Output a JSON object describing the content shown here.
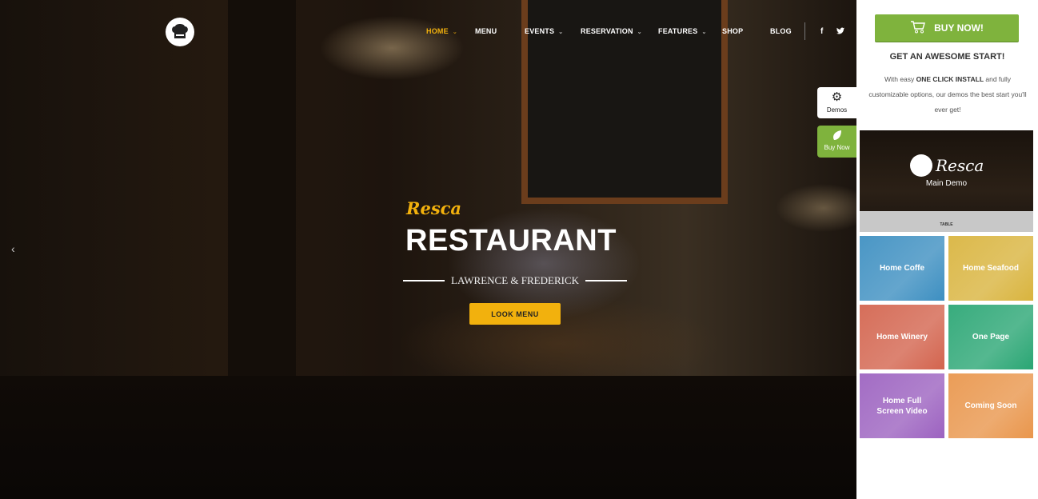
{
  "nav": {
    "items": [
      {
        "label": "HOME",
        "dropdown": true,
        "active": true
      },
      {
        "label": "MENU",
        "dropdown": false
      },
      {
        "label": "EVENTS",
        "dropdown": true
      },
      {
        "label": "RESERVATION",
        "dropdown": true
      },
      {
        "label": "FEATURES",
        "dropdown": true
      },
      {
        "label": "SHOP",
        "dropdown": false
      },
      {
        "label": "BLOG",
        "dropdown": false
      }
    ],
    "social": {
      "facebook": "f",
      "twitter": "twitter-icon"
    }
  },
  "hero": {
    "script_title": "Resca",
    "title": "RESTAURANT",
    "subtitle": "LAWRENCE & FREDERICK",
    "button": "LOOK MENU"
  },
  "side_tabs": {
    "demos": "Demos",
    "buy": "Buy Now"
  },
  "panel": {
    "buy_button": "BUY NOW!",
    "heading": "GET AN AWESOME START!",
    "desc_pre": "With easy ",
    "desc_bold": "ONE CLICK INSTALL",
    "desc_post": " and fully customizable options, our demos the best start you'll ever get!",
    "main_demo": {
      "brand": "Resca",
      "label": "Main Demo",
      "strip": "TABLE"
    },
    "demos": [
      {
        "label": "Home Coffe",
        "color": "#3d8fc1"
      },
      {
        "label": "Home Seafood",
        "color": "#d9b43e"
      },
      {
        "label": "Home Winery",
        "color": "#d3644e"
      },
      {
        "label": "One Page",
        "color": "#2aa674"
      },
      {
        "label": "Home Full Screen Video",
        "color": "#9c62c0"
      },
      {
        "label": "Coming Soon",
        "color": "#e9964c"
      }
    ]
  },
  "colors": {
    "accent": "#f2b10d",
    "green": "#7fb33d"
  }
}
